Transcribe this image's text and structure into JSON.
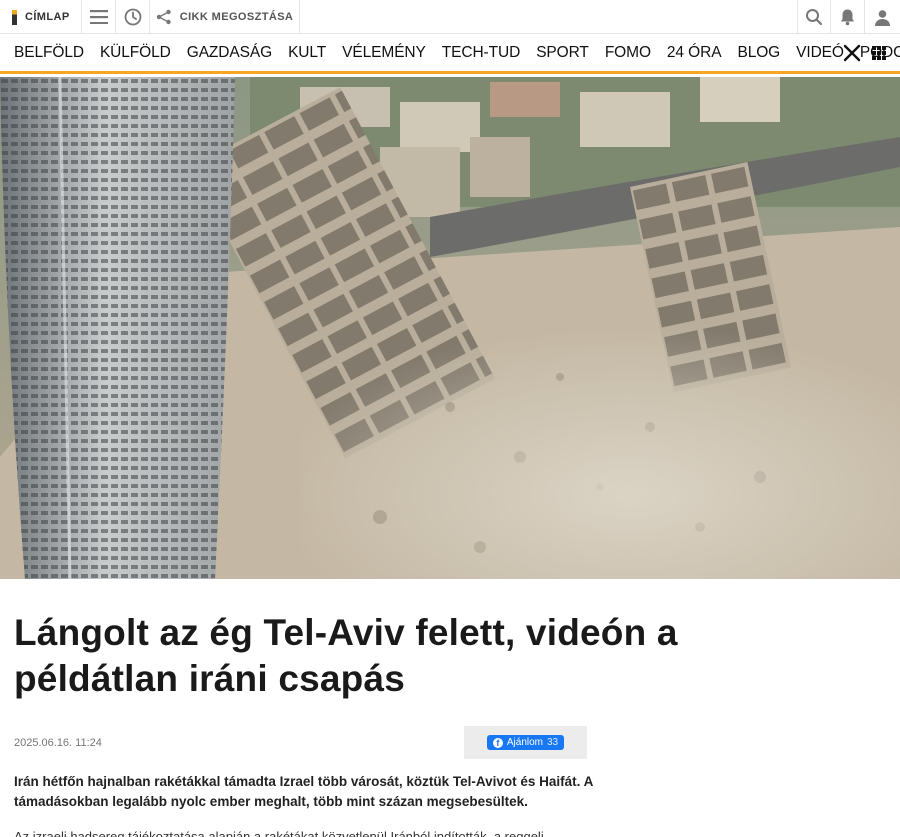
{
  "topbar": {
    "home_label": "CÍMLAP",
    "share_label": "CIKK MEGOSZTÁSA",
    "icons": [
      "menu-icon",
      "clock-icon",
      "share-icon",
      "search-icon",
      "bell-icon",
      "user-icon"
    ]
  },
  "nav": {
    "items": [
      "BELFÖLD",
      "KÜLFÖLD",
      "GAZDASÁG",
      "KULT",
      "VÉLEMÉNY",
      "TECH-TUD",
      "SPORT",
      "FOMO",
      "24 ÓRA",
      "BLOG",
      "VIDEÓ",
      "PODCAST"
    ],
    "icons": [
      "x-logo-icon",
      "apps-grid-icon"
    ]
  },
  "article": {
    "title": "Lángolt az ég Tel-Aviv felett, videón a példátlan iráni csapás",
    "date": "2025.06.16. 11:24",
    "fb_label": "Ajánlom",
    "fb_count": "33",
    "lead": "Irán hétfőn hajnalban rakétákkal támadta Izrael több városát, köztük Tel-Avivot és Haifát. A támadásokban legalább nyolc ember meghalt, több mint százan megsebesültek.",
    "body_partial": "Az izraeli hadsereg tájékoztatása alapján a rakétákat közvetlenül Iránból indították, a reggeli"
  },
  "colors": {
    "accent": "#f5a623",
    "facebook": "#1877f2"
  }
}
